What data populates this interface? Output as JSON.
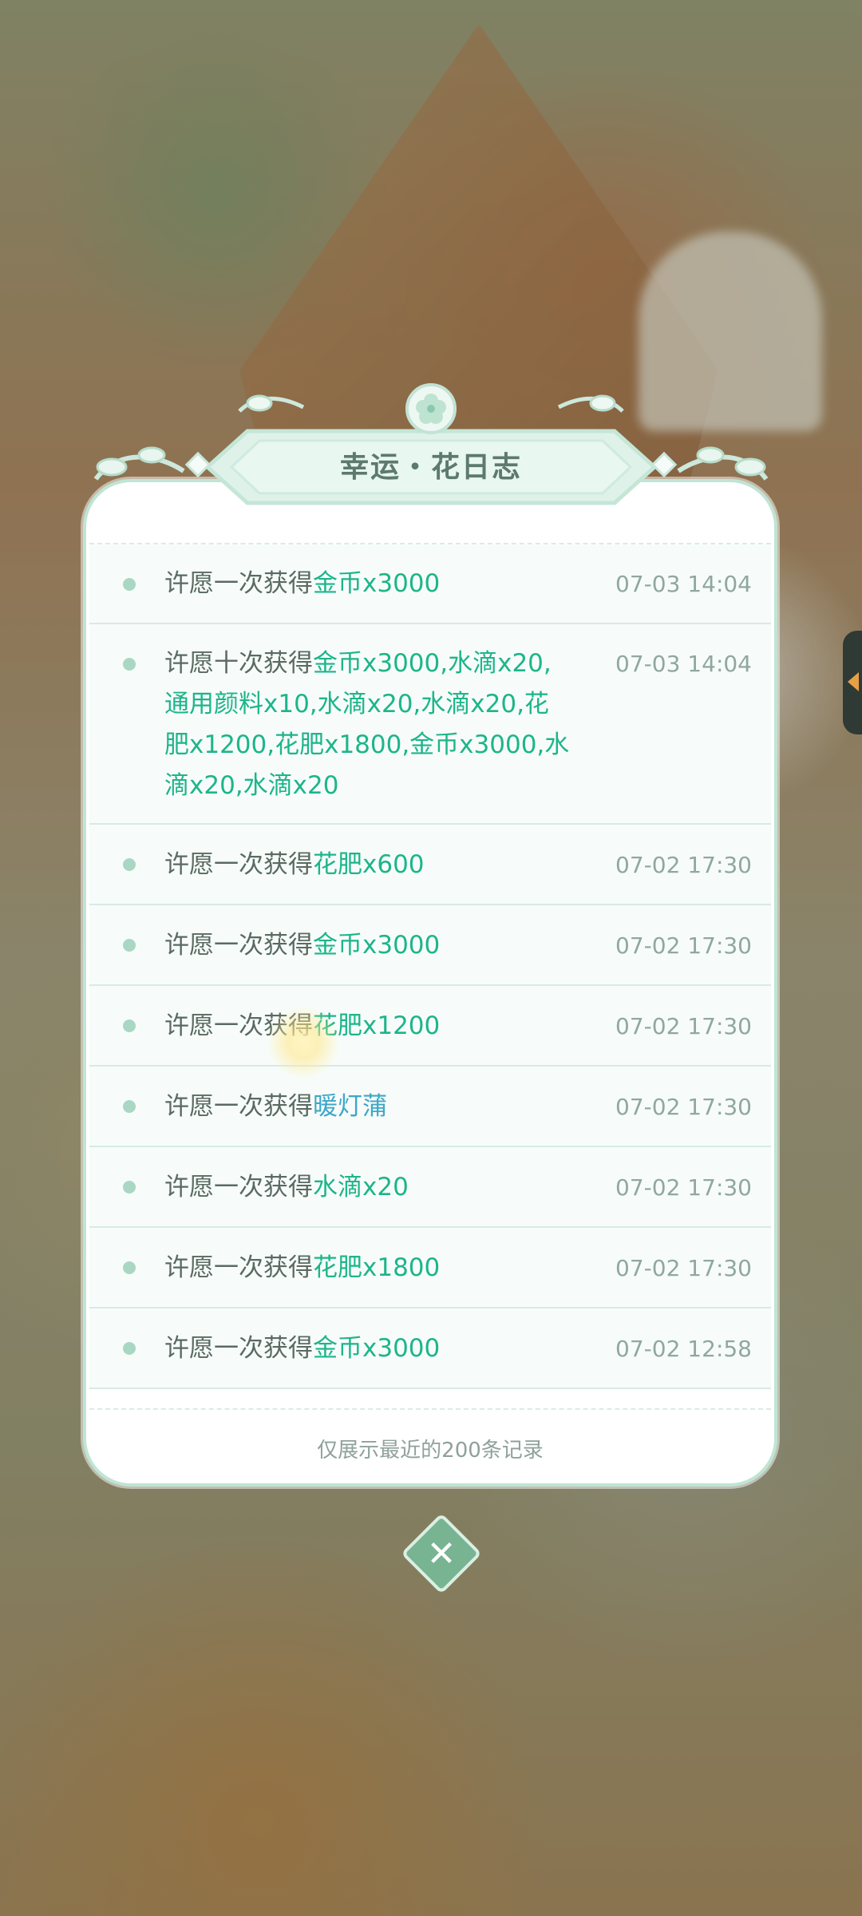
{
  "panel": {
    "title": "幸运・花日志",
    "footer_note": "仅展示最近的200条记录"
  },
  "records": [
    {
      "prefix": "许愿一次获得",
      "reward": "金币x3000",
      "reward_color": "green",
      "time": "07-03 14:04"
    },
    {
      "prefix": "许愿十次获得",
      "reward_lines": [
        "金币x3000,水滴x20,",
        "通用颜料x10,水滴x20,水滴x20,花",
        "肥x1200,花肥x1800,金币x3000,水",
        "滴x20,水滴x20"
      ],
      "reward_color": "green",
      "time": "07-03 14:04"
    },
    {
      "prefix": "许愿一次获得",
      "reward": "花肥x600",
      "reward_color": "green",
      "time": "07-02 17:30"
    },
    {
      "prefix": "许愿一次获得",
      "reward": "金币x3000",
      "reward_color": "green",
      "time": "07-02 17:30"
    },
    {
      "prefix": "许愿一次获得",
      "reward": "花肥x1200",
      "reward_color": "green",
      "time": "07-02 17:30"
    },
    {
      "prefix": "许愿一次获得",
      "reward": "暖灯蒲",
      "reward_color": "blue",
      "time": "07-02 17:30"
    },
    {
      "prefix": "许愿一次获得",
      "reward": "水滴x20",
      "reward_color": "green",
      "time": "07-02 17:30"
    },
    {
      "prefix": "许愿一次获得",
      "reward": "花肥x1800",
      "reward_color": "green",
      "time": "07-02 17:30"
    },
    {
      "prefix": "许愿一次获得",
      "reward": "金币x3000",
      "reward_color": "green",
      "time": "07-02 12:58"
    }
  ],
  "colors": {
    "accent_green": "#1db58a",
    "accent_blue": "#3ea7c7",
    "panel_border": "#bfe5d4"
  },
  "icons": {
    "close": "close-icon",
    "side_handle": "triangle-left-icon"
  }
}
